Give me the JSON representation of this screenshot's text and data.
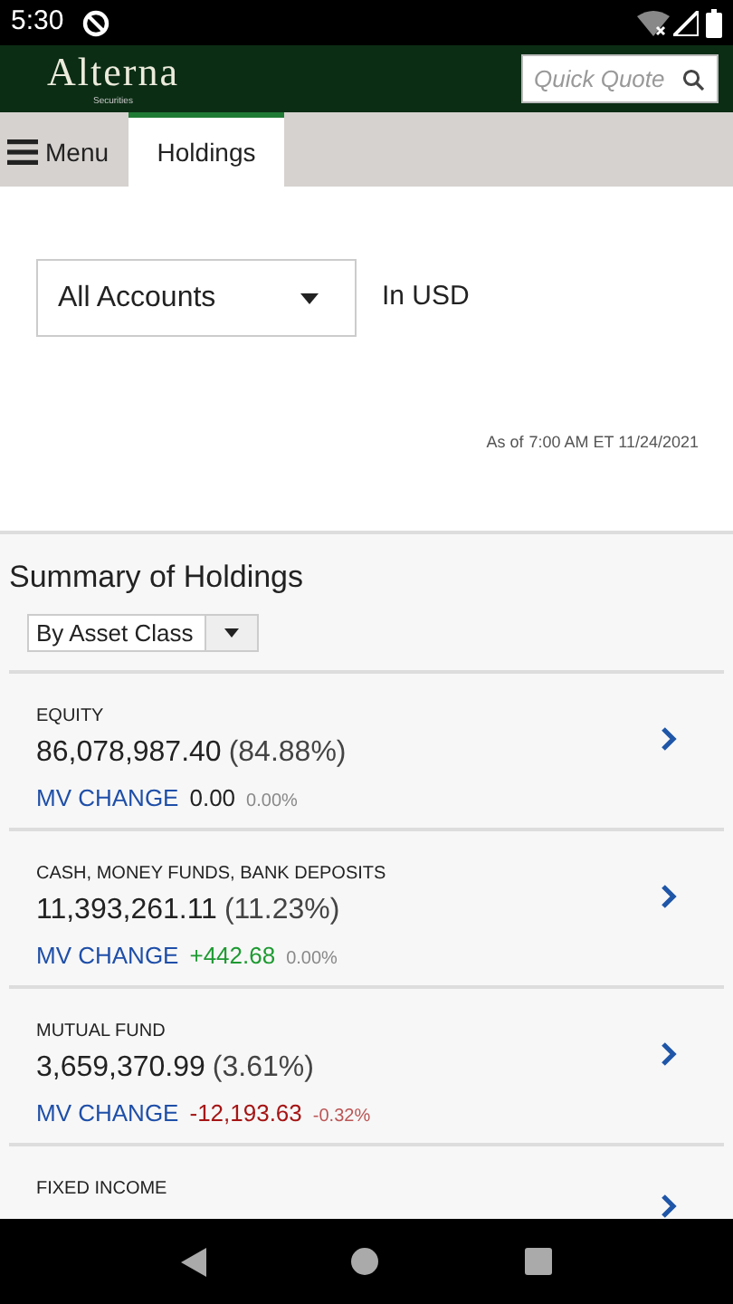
{
  "status_bar": {
    "time": "5:30"
  },
  "header": {
    "logo": "Alterna",
    "logo_sub": "Securities",
    "search": {
      "placeholder": "Quick Quote"
    }
  },
  "tabs": [
    {
      "label": "Menu",
      "kind": "menu",
      "selected": false
    },
    {
      "label": "Holdings",
      "kind": "tab",
      "selected": true
    }
  ],
  "account": {
    "value": "All Accounts",
    "currency": "In USD"
  },
  "as_of": {
    "label": "As of",
    "time": "7:00 AM ET 11/24/2021"
  },
  "summary": {
    "title": "Summary of Holdings",
    "grouping": "By Asset Class",
    "items": [
      {
        "category": "EQUITY",
        "value": "86,078,987.40",
        "share": "(84.88%)",
        "change_label": "MV CHANGE",
        "change": "0.00",
        "change_pct": "0.00%",
        "color": "#222222"
      },
      {
        "category": "CASH, MONEY FUNDS, BANK DEPOSITS",
        "value": "11,393,261.11",
        "share": "(11.23%)",
        "change_label": "MV CHANGE",
        "change": "+442.68",
        "change_pct": "0.00%",
        "color": "#1e9a32"
      },
      {
        "category": "MUTUAL FUND",
        "value": "3,659,370.99",
        "share": "(3.61%)",
        "change_label": "MV CHANGE",
        "change": "-12,193.63",
        "change_pct": "-0.32%",
        "color": "#a51515"
      },
      {
        "category": "FIXED INCOME"
      }
    ]
  }
}
